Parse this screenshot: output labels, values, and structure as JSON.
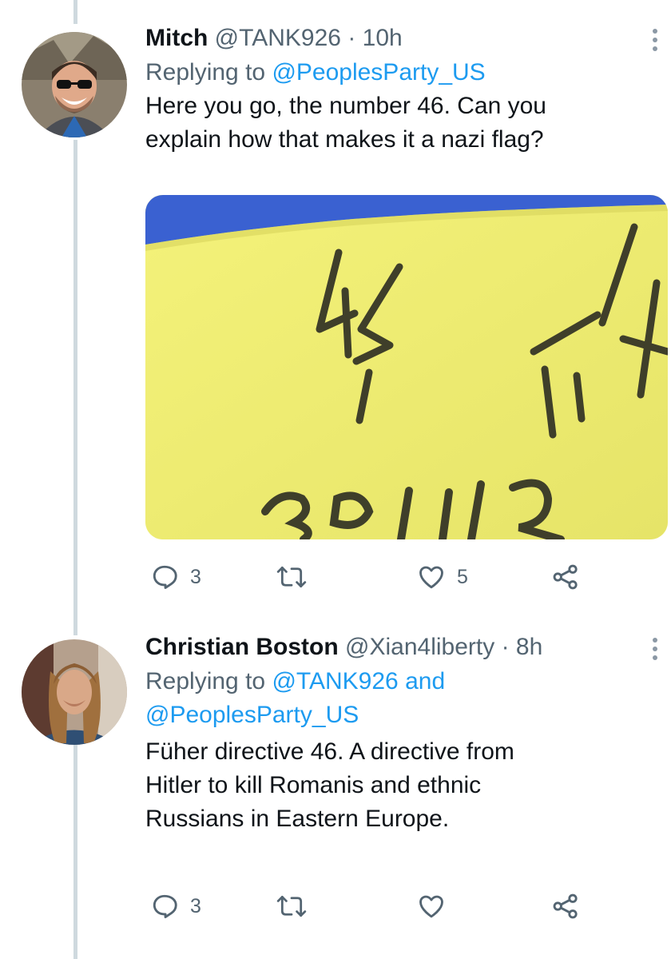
{
  "tweets": [
    {
      "name": "Mitch",
      "handle": "@TANK926",
      "dot": "·",
      "time": "10h",
      "reply_prefix": "Replying to ",
      "reply_to_1": "@PeoplesParty_US",
      "text_line_1": "Here you go, the number 46. Can you",
      "text_line_2": "explain how that makes it a nazi flag?",
      "media_caption_text": "46",
      "replies_count": "3",
      "likes_count": "5"
    },
    {
      "name": "Christian Boston",
      "handle": "@Xian4liberty",
      "dot": "·",
      "time": "8h",
      "reply_prefix": "Replying to ",
      "reply_to_1": "@TANK926",
      "reply_joiner": " and",
      "reply_to_2": "@PeoplesParty_US",
      "text_line_1": "Füher directive 46. A directive from",
      "text_line_2": "Hitler to kill Romanis and ethnic",
      "text_line_3": "Russians in Eastern Europe.",
      "replies_count": "3"
    }
  ],
  "icons": {
    "reply": "reply-icon",
    "retweet": "retweet-icon",
    "like": "heart-icon",
    "share": "share-icon",
    "more": "more-options-icon"
  },
  "colors": {
    "link": "#1d9bf0",
    "secondary_text": "#536471",
    "thread_line": "#cfd9de",
    "flag_yellow": "#f1ef77",
    "flag_blue": "#3a61d1"
  }
}
